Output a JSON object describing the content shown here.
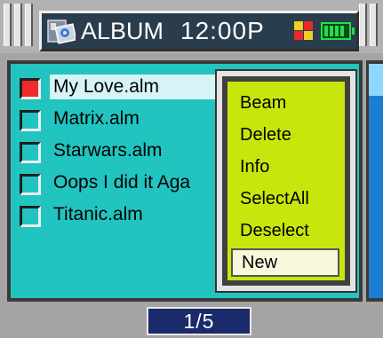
{
  "header": {
    "title": "ALBUM",
    "time": "12:00P",
    "icons": [
      "album-app-icon",
      "color-grid-icon",
      "battery-icon"
    ]
  },
  "files": [
    {
      "name": "My Love.alm",
      "checked": true,
      "selected": true
    },
    {
      "name": "Matrix.alm",
      "checked": false,
      "selected": false
    },
    {
      "name": "Starwars.alm",
      "checked": false,
      "selected": false
    },
    {
      "name": "Oops I did it Aga",
      "checked": false,
      "selected": false
    },
    {
      "name": "Titanic.alm",
      "checked": false,
      "selected": false
    }
  ],
  "menu": {
    "items": [
      "Beam",
      "Delete",
      "Info",
      "SelectAll",
      "Deselect",
      "New"
    ],
    "selected": "New"
  },
  "pager": "1/5",
  "colors": {
    "list_bg": "#22c4c0",
    "menu_bg": "#c8e60c",
    "checked": "#ef2a2a",
    "titlebar": "#2a3d4c",
    "pager_bg": "#1a2a6a",
    "battery": "#22e04a"
  }
}
